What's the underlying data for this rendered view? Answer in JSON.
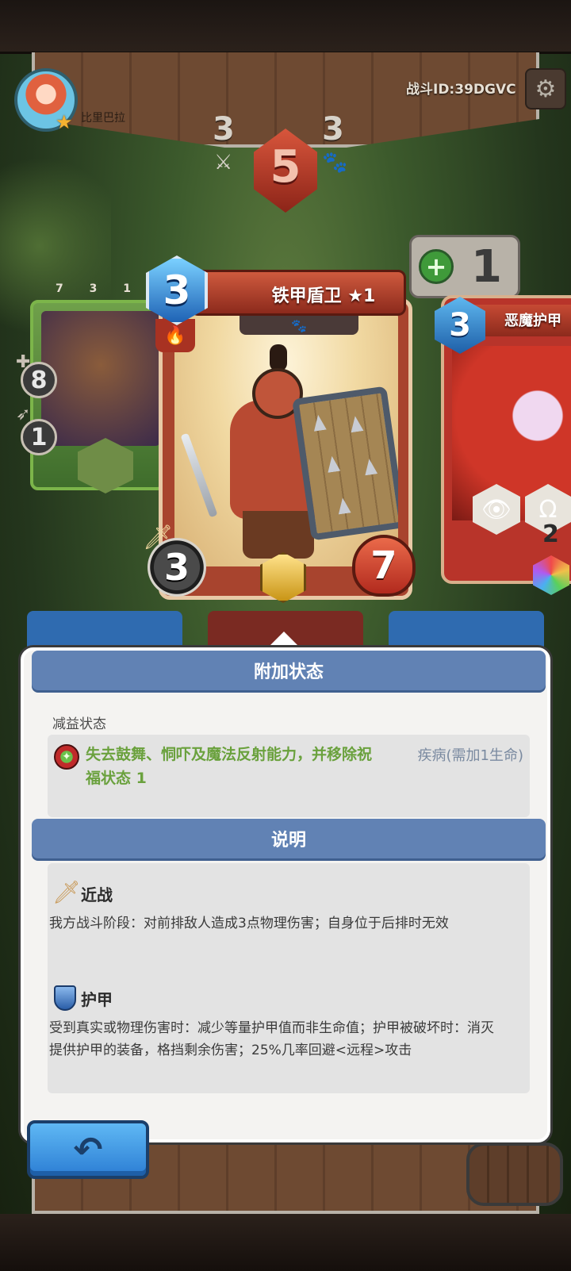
{
  "header": {
    "player_name": "比里巴拉",
    "battle_id": "战斗ID:39DGVC"
  },
  "turn": {
    "left_count": "3",
    "center_count": "5",
    "right_count": "3"
  },
  "side_left": {
    "mini_stats": "7 3 1",
    "heal": "8",
    "attack": "1"
  },
  "side_right": {
    "heal_count": "1",
    "card_title": "恶魔护甲",
    "cost": "3",
    "hex_count": "2"
  },
  "card": {
    "title": "铁甲盾卫 ★1",
    "cost": "3",
    "attack": "3",
    "health": "7"
  },
  "popup": {
    "status_header": "附加状态",
    "debuff_label": "减益状态",
    "debuff_desc": "失去鼓舞、恫吓及魔法反射能力，并移除祝福状态 1",
    "debuff_name": "疾病(需加1生命)",
    "explain_header": "说明",
    "keywords": [
      {
        "name": "近战",
        "text": "我方战斗阶段：对前排敌人造成3点物理伤害；自身位于后排时无效"
      },
      {
        "name": "护甲",
        "text": "受到真实或物理伤害时：减少等量护甲值而非生命值；护甲被破坏时：消灭提供护甲的装备，格挡剩余伤害；25%几率回避<远程>攻击"
      }
    ]
  },
  "icons": {
    "settings": "gear-icon",
    "back": "back-arrow-icon",
    "sword": "sword-icon",
    "paw": "paw-icon",
    "shield": "shield-icon",
    "fire": "fire-icon"
  },
  "colors": {
    "section_header": "#6182b4",
    "debuff_text": "#6aa13d",
    "debuff_name": "#7a8aa0",
    "back_button": "#3f97e4"
  }
}
